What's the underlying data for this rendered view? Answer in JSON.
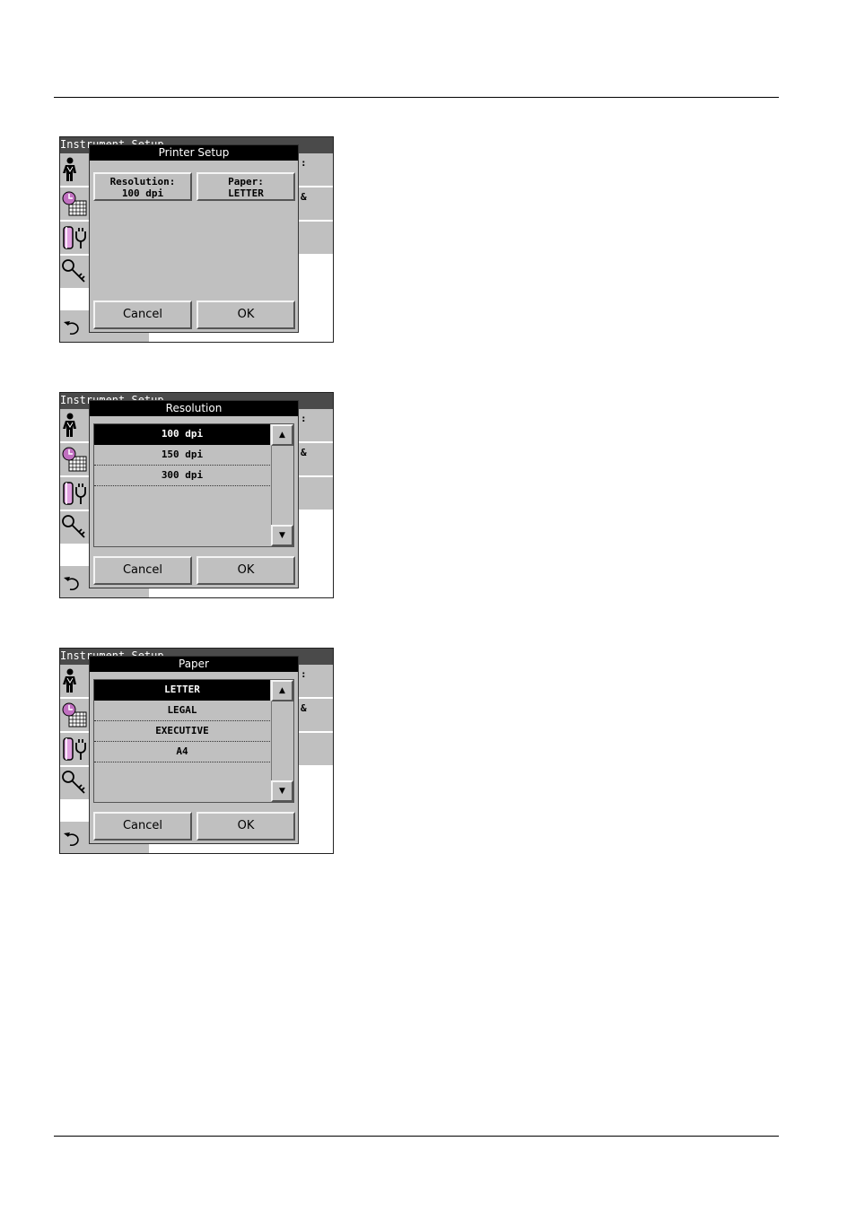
{
  "screens": [
    {
      "window_title": "Instrument Setup",
      "right_labels": [
        ":",
        "&",
        ""
      ],
      "dialog": {
        "title": "Printer Setup",
        "settings": [
          {
            "label": "Resolution:",
            "value": "100 dpi"
          },
          {
            "label": "Paper:",
            "value": "LETTER"
          }
        ],
        "cancel": "Cancel",
        "ok": "OK"
      }
    },
    {
      "window_title": "Instrument Setup",
      "right_labels": [
        ":",
        "&",
        ""
      ],
      "dialog": {
        "title": "Resolution",
        "items": [
          "100 dpi",
          "150 dpi",
          "300 dpi"
        ],
        "selected_index": 0,
        "scroll_up": "▲",
        "scroll_down": "▼",
        "cancel": "Cancel",
        "ok": "OK"
      }
    },
    {
      "window_title": "Instrument Setup",
      "right_labels": [
        ":",
        "&",
        ""
      ],
      "dialog": {
        "title": "Paper",
        "items": [
          "LETTER",
          "LEGAL",
          "EXECUTIVE",
          "A4"
        ],
        "selected_index": 0,
        "scroll_up": "▲",
        "scroll_down": "▼",
        "cancel": "Cancel",
        "ok": "OK"
      }
    }
  ],
  "icons": [
    "person-icon",
    "clock-calendar-icon",
    "lamp-power-icon",
    "key-icon",
    "back-arrow-icon"
  ]
}
